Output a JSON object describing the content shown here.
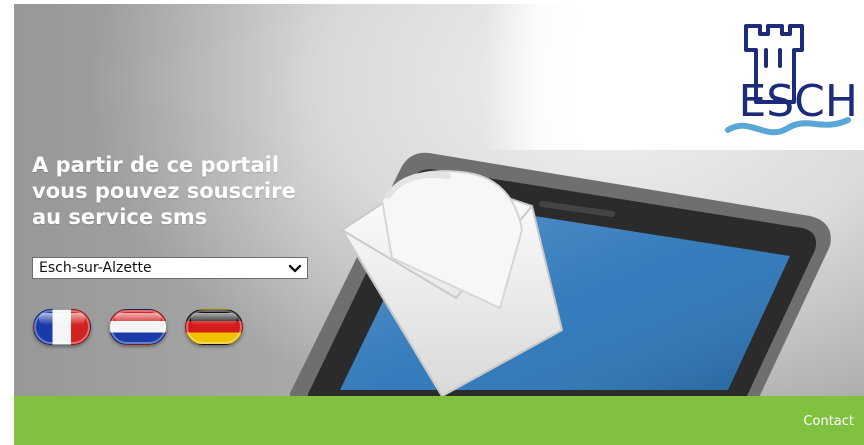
{
  "brand": {
    "logo_text": "ESCH"
  },
  "hero": {
    "headline_lines": [
      "A partir de ce portail",
      "vous pouvez souscrire",
      "au service sms"
    ]
  },
  "commune_select": {
    "selected": "Esch-sur-Alzette"
  },
  "languages": [
    {
      "icon": "france-flag-icon"
    },
    {
      "icon": "netherlands-flag-icon"
    },
    {
      "icon": "germany-flag-icon"
    }
  ],
  "footer": {
    "contact_label": "Contact"
  },
  "colors": {
    "footer_green": "#80c13f",
    "logo_blue": "#1c2b7a",
    "logo_wave": "#5aa6d6"
  }
}
